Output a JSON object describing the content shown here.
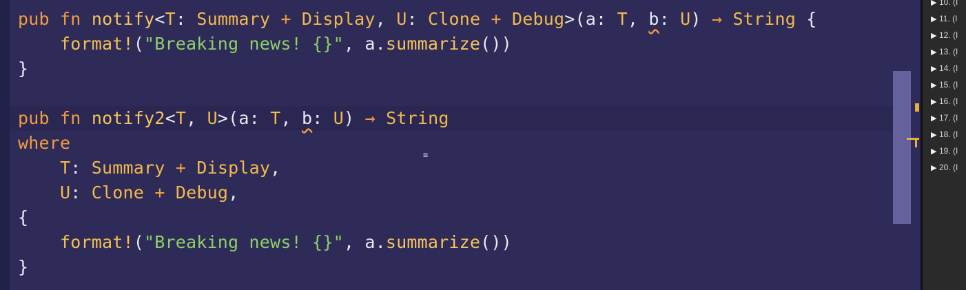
{
  "editor": {
    "lines": [
      {
        "tokens": [
          {
            "t": "pub",
            "c": "kw"
          },
          {
            "t": " ",
            "c": "p"
          },
          {
            "t": "fn",
            "c": "kw"
          },
          {
            "t": " ",
            "c": "p"
          },
          {
            "t": "notify",
            "c": "fn"
          },
          {
            "t": "<",
            "c": "p"
          },
          {
            "t": "T",
            "c": "ty"
          },
          {
            "t": ": ",
            "c": "p"
          },
          {
            "t": "Summary",
            "c": "ty"
          },
          {
            "t": " + ",
            "c": "op"
          },
          {
            "t": "Display",
            "c": "ty"
          },
          {
            "t": ", ",
            "c": "p"
          },
          {
            "t": "U",
            "c": "ty"
          },
          {
            "t": ": ",
            "c": "p"
          },
          {
            "t": "Clone",
            "c": "ty"
          },
          {
            "t": " + ",
            "c": "op"
          },
          {
            "t": "Debug",
            "c": "ty"
          },
          {
            "t": ">(",
            "c": "p"
          },
          {
            "t": "a",
            "c": "p"
          },
          {
            "t": ": ",
            "c": "p"
          },
          {
            "t": "T",
            "c": "ty"
          },
          {
            "t": ", ",
            "c": "p"
          },
          {
            "t": "b",
            "c": "sq"
          },
          {
            "t": ": ",
            "c": "p"
          },
          {
            "t": "U",
            "c": "ty"
          },
          {
            "t": ") ",
            "c": "p"
          },
          {
            "t": "→",
            "c": "arrow"
          },
          {
            "t": " ",
            "c": "p"
          },
          {
            "t": "String",
            "c": "ty"
          },
          {
            "t": " {",
            "c": "p"
          }
        ]
      },
      {
        "tokens": [
          {
            "t": "    ",
            "c": "p"
          },
          {
            "t": "format!",
            "c": "mac"
          },
          {
            "t": "(",
            "c": "p"
          },
          {
            "t": "\"Breaking news! {}\"",
            "c": "str"
          },
          {
            "t": ", ",
            "c": "p"
          },
          {
            "t": "a",
            "c": "p"
          },
          {
            "t": ".",
            "c": "p"
          },
          {
            "t": "summarize",
            "c": "meth"
          },
          {
            "t": "())",
            "c": "p"
          }
        ]
      },
      {
        "tokens": [
          {
            "t": "}",
            "c": "p"
          }
        ]
      },
      {
        "tokens": []
      },
      {
        "highlight": true,
        "tokens": [
          {
            "t": "pub",
            "c": "kw"
          },
          {
            "t": " ",
            "c": "p"
          },
          {
            "t": "fn",
            "c": "kw"
          },
          {
            "t": " ",
            "c": "p"
          },
          {
            "t": "notify2",
            "c": "fn"
          },
          {
            "t": "<",
            "c": "p"
          },
          {
            "t": "T",
            "c": "ty"
          },
          {
            "t": ", ",
            "c": "p"
          },
          {
            "t": "U",
            "c": "ty"
          },
          {
            "t": ">(",
            "c": "p"
          },
          {
            "t": "a",
            "c": "p"
          },
          {
            "t": ": ",
            "c": "p"
          },
          {
            "t": "T",
            "c": "ty"
          },
          {
            "t": ", ",
            "c": "p"
          },
          {
            "t": "b",
            "c": "sq"
          },
          {
            "t": ": ",
            "c": "p"
          },
          {
            "t": "U",
            "c": "ty"
          },
          {
            "t": ") ",
            "c": "p"
          },
          {
            "t": "→",
            "c": "arrow"
          },
          {
            "t": " ",
            "c": "p"
          },
          {
            "t": "String",
            "c": "ty"
          }
        ]
      },
      {
        "tokens": [
          {
            "t": "where",
            "c": "kw"
          }
        ]
      },
      {
        "tokens": [
          {
            "t": "    ",
            "c": "p"
          },
          {
            "t": "T",
            "c": "ty"
          },
          {
            "t": ": ",
            "c": "p"
          },
          {
            "t": "Summary",
            "c": "ty"
          },
          {
            "t": " + ",
            "c": "op"
          },
          {
            "t": "Display",
            "c": "ty"
          },
          {
            "t": ",",
            "c": "p"
          }
        ]
      },
      {
        "tokens": [
          {
            "t": "    ",
            "c": "p"
          },
          {
            "t": "U",
            "c": "ty"
          },
          {
            "t": ": ",
            "c": "p"
          },
          {
            "t": "Clone",
            "c": "ty"
          },
          {
            "t": " + ",
            "c": "op"
          },
          {
            "t": "Debug",
            "c": "ty"
          },
          {
            "t": ",",
            "c": "p"
          }
        ]
      },
      {
        "tokens": [
          {
            "t": "{",
            "c": "p"
          }
        ]
      },
      {
        "tokens": [
          {
            "t": "    ",
            "c": "p"
          },
          {
            "t": "format!",
            "c": "mac"
          },
          {
            "t": "(",
            "c": "p"
          },
          {
            "t": "\"Breaking news! {}\"",
            "c": "str"
          },
          {
            "t": ", ",
            "c": "p"
          },
          {
            "t": "a",
            "c": "p"
          },
          {
            "t": ".",
            "c": "p"
          },
          {
            "t": "summarize",
            "c": "meth"
          },
          {
            "t": "())",
            "c": "p"
          }
        ]
      },
      {
        "tokens": [
          {
            "t": "}",
            "c": "p"
          }
        ]
      }
    ]
  },
  "toc": {
    "items": [
      {
        "label": "10. (I"
      },
      {
        "label": "11. (I"
      },
      {
        "label": "12. (I"
      },
      {
        "label": "13. (I"
      },
      {
        "label": "14. (I"
      },
      {
        "label": "15. (I"
      },
      {
        "label": "16. (I"
      },
      {
        "label": "17. (I"
      },
      {
        "label": "18. (I"
      },
      {
        "label": "19. (I"
      },
      {
        "label": "20. (I"
      }
    ]
  },
  "colors": {
    "editor_bg": "#2e2b59",
    "keyword": "#f39c3d",
    "type": "#f3b94b",
    "string": "#8fd066",
    "text": "#e8e8f0"
  }
}
